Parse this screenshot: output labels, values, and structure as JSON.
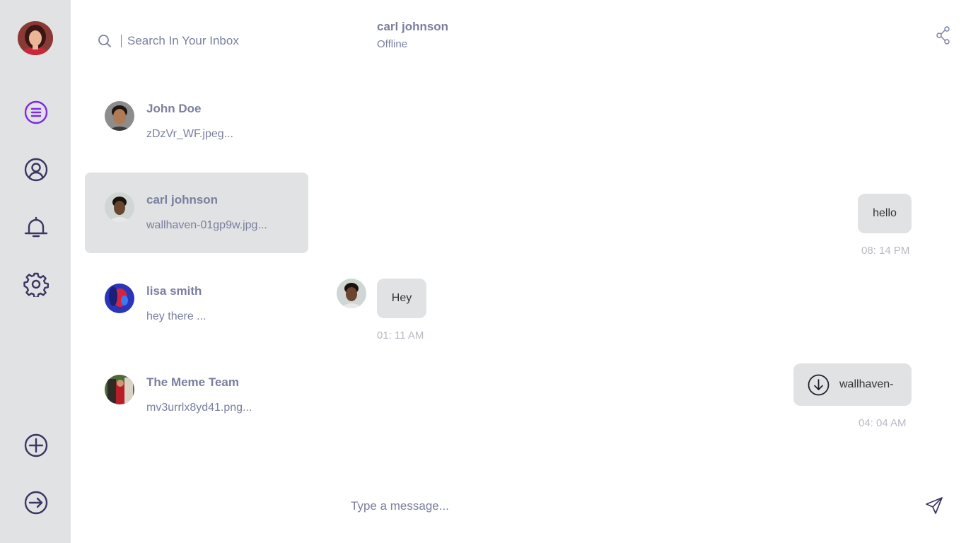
{
  "colors": {
    "sidebar_bg": "#e1e2e4",
    "accent": "#7c2ae8",
    "icon": "#3b3562",
    "text": "#7a7f9e",
    "bubble": "#e1e2e4",
    "time": "#b8bac3"
  },
  "sidebar": {
    "items": [
      {
        "icon": "chat-list-icon",
        "active": true
      },
      {
        "icon": "user-profile-icon"
      },
      {
        "icon": "bell-icon"
      },
      {
        "icon": "gear-icon"
      }
    ],
    "bottom": [
      {
        "icon": "add-circle-icon"
      },
      {
        "icon": "logout-icon"
      }
    ]
  },
  "search": {
    "placeholder": "Search In Your Inbox"
  },
  "contacts": [
    {
      "name": "John Doe",
      "last": "zDzVr_WF.jpeg..."
    },
    {
      "name": "carl johnson",
      "last": "wallhaven-01gp9w.jpg...",
      "active": true
    },
    {
      "name": "lisa smith",
      "last": "hey there ..."
    },
    {
      "name": "The Meme Team",
      "last": "mv3urrlx8yd41.png..."
    }
  ],
  "chat": {
    "name": "carl johnson",
    "status": "Offline",
    "messages": [
      {
        "text": "hello",
        "time": "08: 14 PM",
        "side": "right"
      },
      {
        "text": "Hey",
        "time": "01: 11 AM",
        "side": "left"
      },
      {
        "text": "wallhaven-",
        "time": "04: 04 AM",
        "side": "right",
        "attachment": true
      }
    ],
    "input_placeholder": "Type a message..."
  }
}
